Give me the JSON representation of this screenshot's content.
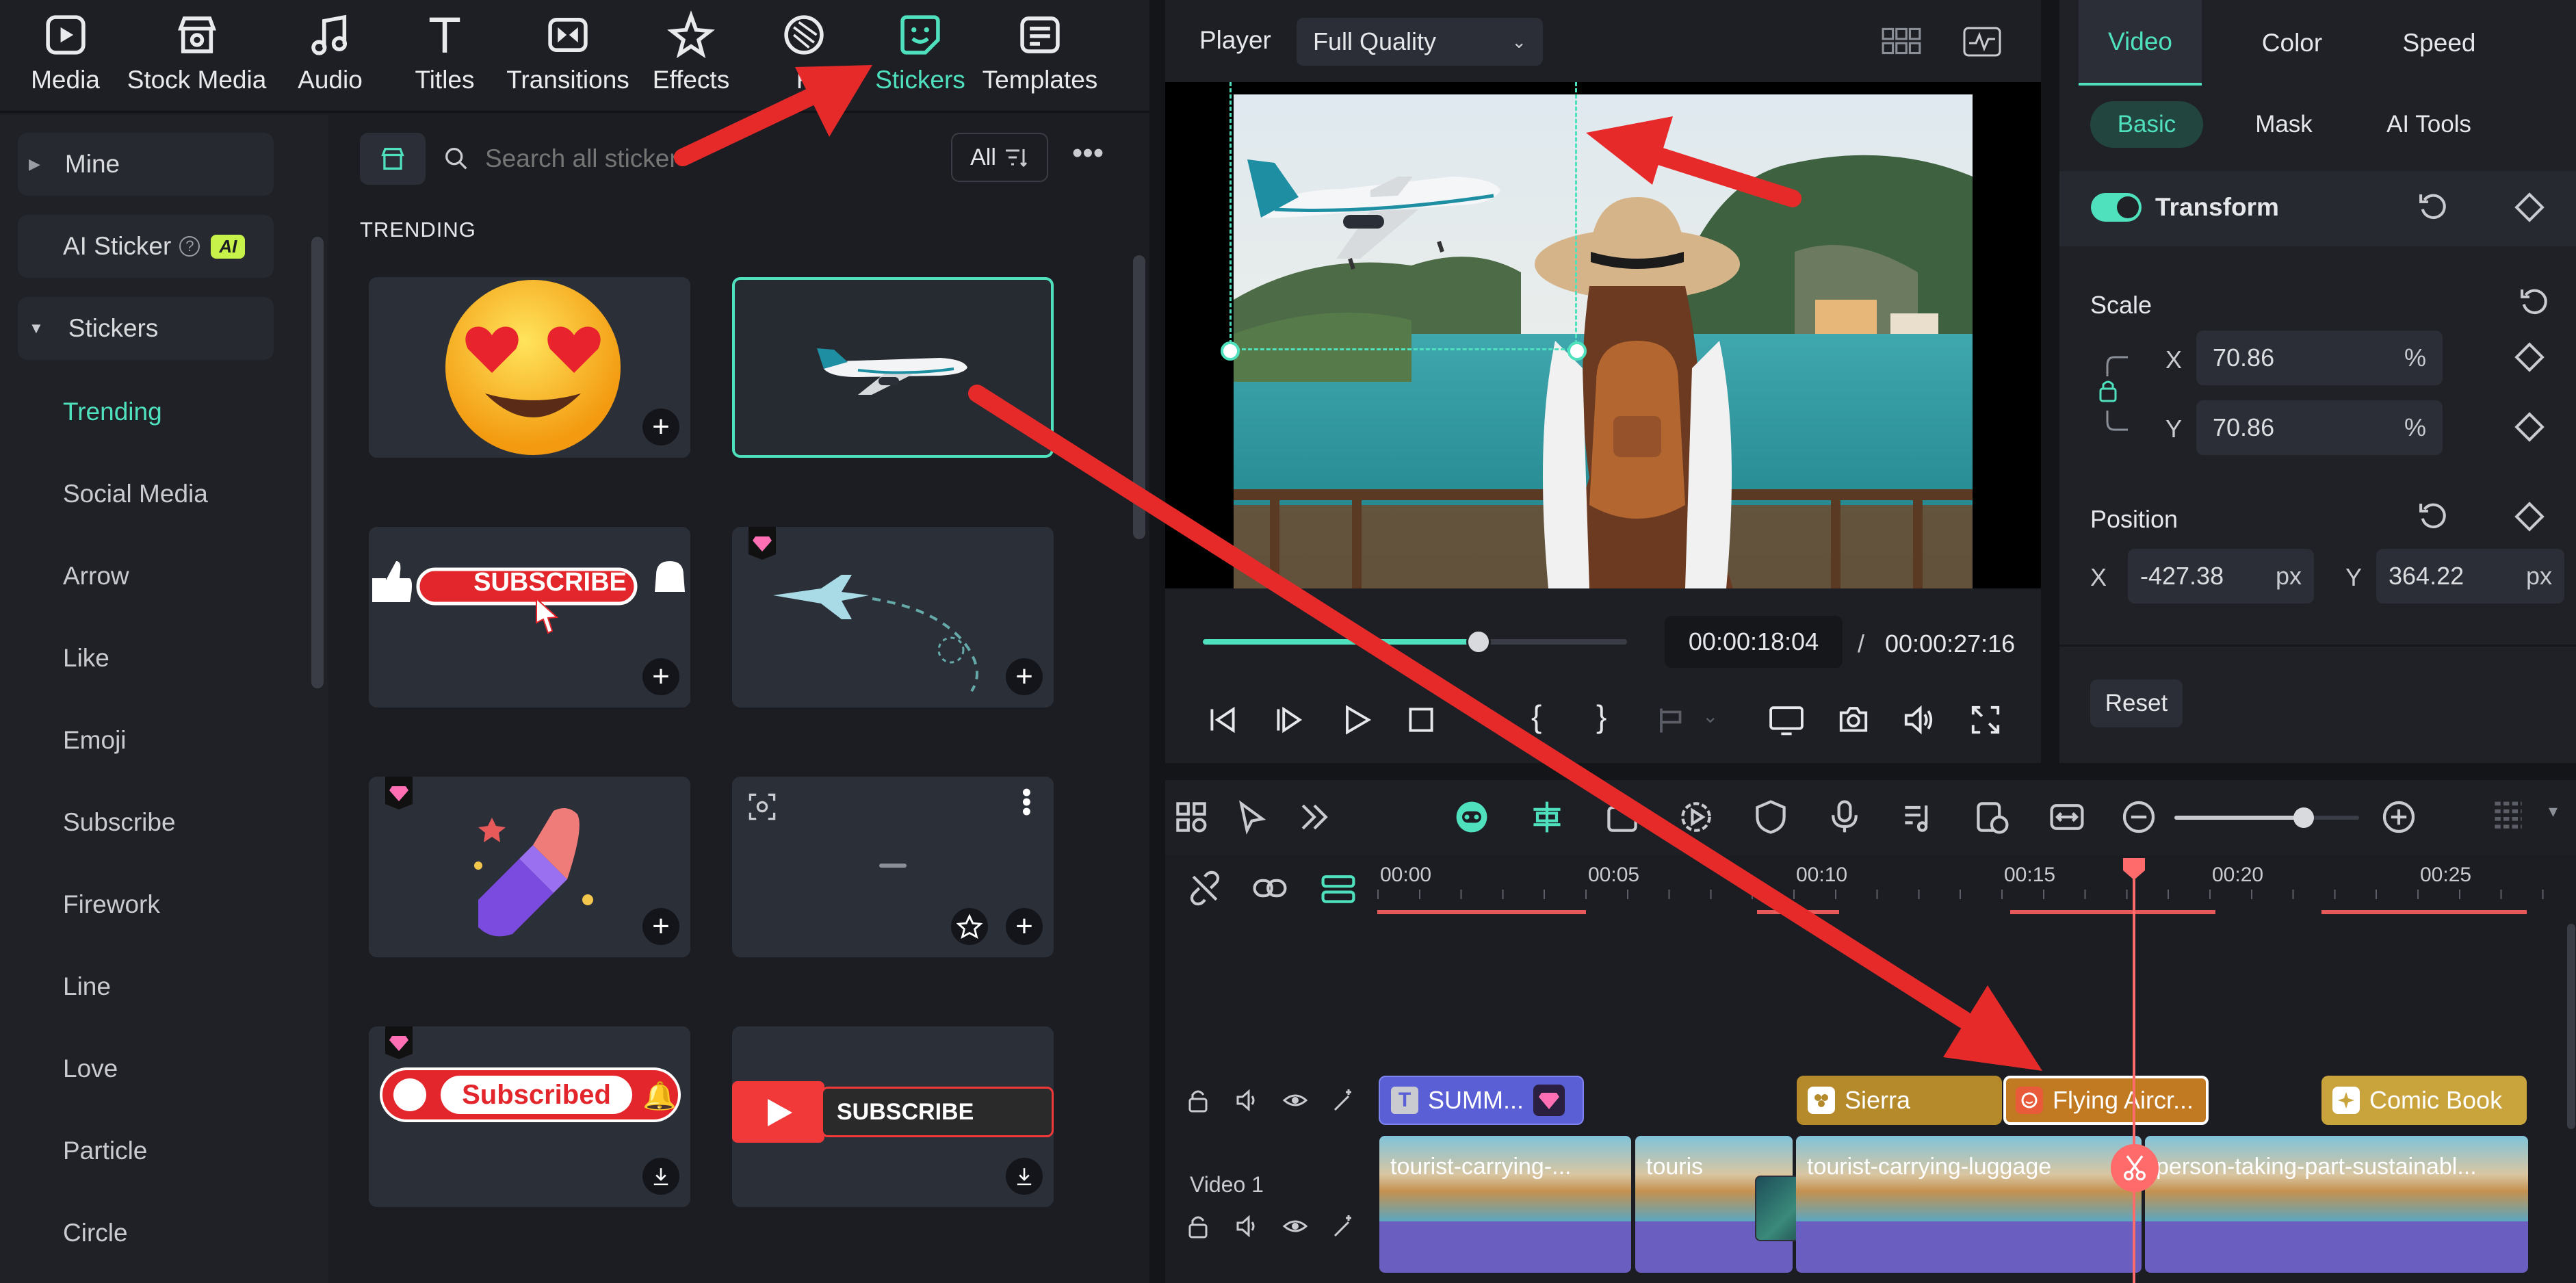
{
  "nav": {
    "items": [
      {
        "label": "Media",
        "icon": "media-icon"
      },
      {
        "label": "Stock Media",
        "icon": "store-icon"
      },
      {
        "label": "Audio",
        "icon": "music-note-icon"
      },
      {
        "label": "Titles",
        "icon": "text-t-icon"
      },
      {
        "label": "Transitions",
        "icon": "transition-icon"
      },
      {
        "label": "Effects",
        "icon": "effects-star-icon"
      },
      {
        "label": "F",
        "icon": "filters-icon"
      },
      {
        "label": "Stickers",
        "icon": "sticker-icon",
        "active": true
      },
      {
        "label": "Templates",
        "icon": "templates-icon"
      }
    ]
  },
  "sidebar": {
    "mine": "Mine",
    "ai_sticker": "AI Sticker",
    "ai_badge": "AI",
    "stickers": "Stickers",
    "items": [
      "Trending",
      "Social Media",
      "Arrow",
      "Like",
      "Emoji",
      "Subscribe",
      "Firework",
      "Line",
      "Love",
      "Particle",
      "Circle"
    ]
  },
  "library": {
    "search_placeholder": "Search all sticker",
    "filter_label": "All",
    "section_title": "TRENDING",
    "stickers": [
      {
        "name": "heart-eyes-emoji"
      },
      {
        "name": "airplane",
        "selected": true
      },
      {
        "name": "subscribe-banner",
        "text": "SUBSCRIBE"
      },
      {
        "name": "dashed-airplane-path",
        "premium": true
      },
      {
        "name": "lipstick",
        "premium": true
      },
      {
        "name": "tiny-plane"
      },
      {
        "name": "subscribed-button",
        "text": "Subscribed",
        "premium": true
      },
      {
        "name": "youtube-subscribe",
        "text": "SUBSCRIBE"
      }
    ]
  },
  "player": {
    "label": "Player",
    "quality": "Full Quality",
    "current_time": "00:00:18:04",
    "separator": "/",
    "total_time": "00:00:27:16",
    "progress": 0.65
  },
  "props": {
    "tabs": [
      "Video",
      "Color",
      "Speed"
    ],
    "active_tab": "Video",
    "subtabs": [
      "Basic",
      "Mask",
      "AI Tools"
    ],
    "active_subtab": "Basic",
    "transform_label": "Transform",
    "scale_label": "Scale",
    "scale_x": "70.86",
    "scale_y": "70.86",
    "scale_unit": "%",
    "x_label": "X",
    "y_label": "Y",
    "position_label": "Position",
    "pos_x": "-427.38",
    "pos_y": "364.22",
    "pos_unit": "px",
    "reset_label": "Reset"
  },
  "timeline": {
    "ruler": [
      "00:00",
      "00:05",
      "00:10",
      "00:15",
      "00:20",
      "00:25"
    ],
    "track_label": "Video 1",
    "zoom_level": 0.7,
    "clips": [
      {
        "label": "SUMM...",
        "color": "#5b5fd6",
        "icon": "title-t-icon"
      },
      {
        "label": "Sierra",
        "color": "#b58a2a",
        "icon": "sticker-clip-icon"
      },
      {
        "label": "Flying Aircr...",
        "color": "#c27a22",
        "icon": "sticker-clip-icon",
        "selected": true
      },
      {
        "label": "Comic Book",
        "color": "#c9a43c",
        "icon": "effect-clip-icon"
      }
    ],
    "video_clips": [
      {
        "label": "tourist-carrying-..."
      },
      {
        "label": "touris"
      },
      {
        "label": "tourist-carrying-luggage"
      },
      {
        "label": "person-taking-part-sustainabl..."
      }
    ]
  },
  "colors": {
    "accent": "#4fe0bd",
    "annotation": "#e62a2a",
    "playhead": "#ff6b6b"
  }
}
